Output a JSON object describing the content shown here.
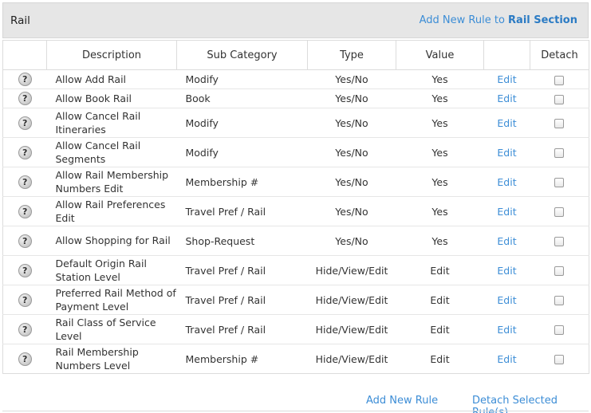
{
  "section": {
    "title": "Rail",
    "add_link_prefix": "Add New Rule to ",
    "add_link_strong": "Rail Section"
  },
  "columns": {
    "help": "",
    "description": "Description",
    "sub_category": "Sub Category",
    "type": "Type",
    "value": "Value",
    "edit": "",
    "detach": "Detach"
  },
  "icons": {
    "help": "question-icon",
    "detach": "checkbox"
  },
  "colors": {
    "link": "#3c8dd6",
    "header_bg": "#e6e6e6"
  },
  "rows": [
    {
      "description": "Allow Add Rail",
      "sub_category": "Modify",
      "type": "Yes/No",
      "value": "Yes",
      "edit": "Edit",
      "detached": false
    },
    {
      "description": "Allow Book Rail",
      "sub_category": "Book",
      "type": "Yes/No",
      "value": "Yes",
      "edit": "Edit",
      "detached": false
    },
    {
      "description": "Allow Cancel Rail Itineraries",
      "sub_category": "Modify",
      "type": "Yes/No",
      "value": "Yes",
      "edit": "Edit",
      "detached": false
    },
    {
      "description": "Allow Cancel Rail Segments",
      "sub_category": "Modify",
      "type": "Yes/No",
      "value": "Yes",
      "edit": "Edit",
      "detached": false
    },
    {
      "description": "Allow Rail Membership Numbers Edit",
      "sub_category": "Membership #",
      "type": "Yes/No",
      "value": "Yes",
      "edit": "Edit",
      "detached": false
    },
    {
      "description": "Allow Rail Preferences Edit",
      "sub_category": "Travel Pref / Rail",
      "type": "Yes/No",
      "value": "Yes",
      "edit": "Edit",
      "detached": false
    },
    {
      "description": "Allow Shopping for Rail",
      "sub_category": "Shop-Request",
      "type": "Yes/No",
      "value": "Yes",
      "edit": "Edit",
      "detached": false
    },
    {
      "description": "Default Origin Rail Station Level",
      "sub_category": "Travel Pref / Rail",
      "type": "Hide/View/Edit",
      "value": "Edit",
      "edit": "Edit",
      "detached": false
    },
    {
      "description": "Preferred Rail Method of Payment Level",
      "sub_category": "Travel Pref / Rail",
      "type": "Hide/View/Edit",
      "value": "Edit",
      "edit": "Edit",
      "detached": false
    },
    {
      "description": "Rail Class of Service Level",
      "sub_category": "Travel Pref / Rail",
      "type": "Hide/View/Edit",
      "value": "Edit",
      "edit": "Edit",
      "detached": false
    },
    {
      "description": "Rail Membership Numbers Level",
      "sub_category": "Membership #",
      "type": "Hide/View/Edit",
      "value": "Edit",
      "edit": "Edit",
      "detached": false
    }
  ],
  "footer": {
    "add_rule": "Add New Rule",
    "detach_selected": "Detach Selected Rule(s)"
  }
}
